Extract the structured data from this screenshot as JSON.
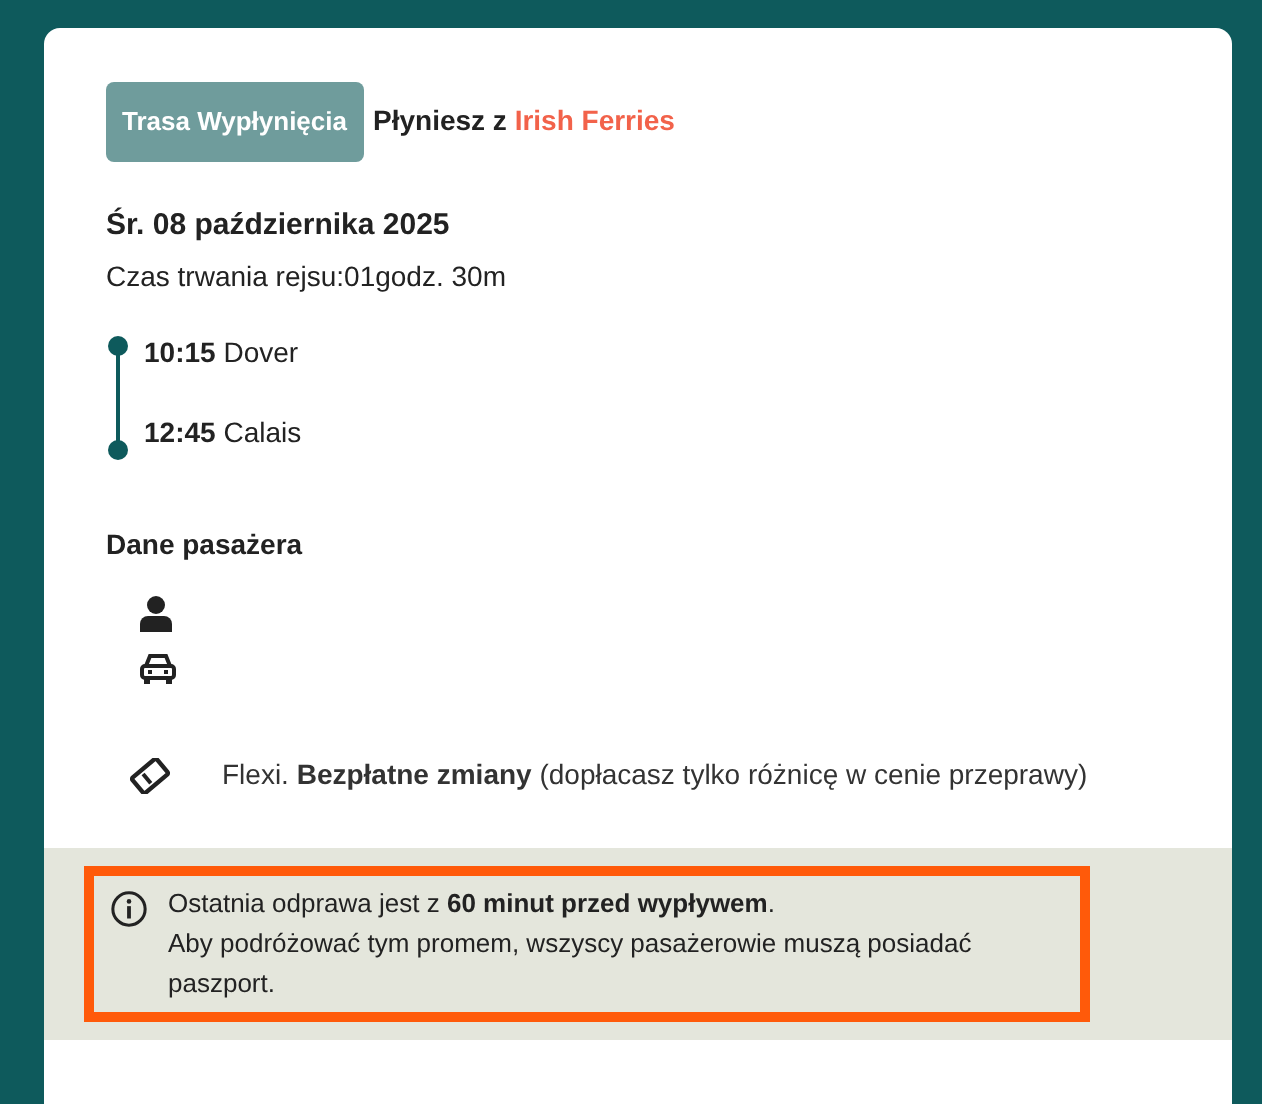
{
  "route_badge": "Trasa Wypłynięcia",
  "operator_prefix": "Płyniesz z",
  "operator": "Irish Ferries",
  "date": "Śr. 08 października 2025",
  "duration": "Czas trwania rejsu:01godz. 30m",
  "stops": [
    {
      "time": "10:15",
      "place": "Dover"
    },
    {
      "time": "12:45",
      "place": "Calais"
    }
  ],
  "passenger_heading": "Dane pasażera",
  "passengers": [
    {
      "kind": "person"
    },
    {
      "kind": "car"
    }
  ],
  "fare": "Flexi. **Bezpłatne zmiany** (dopłacasz tylko różnicę w cenie przeprawy)",
  "notice": [
    "Ostatnia odprawa jest z **60 minut przed wypływem**.",
    "Aby podróżować tym promem, wszyscy pasażerowie muszą posiadać paszport."
  ]
}
